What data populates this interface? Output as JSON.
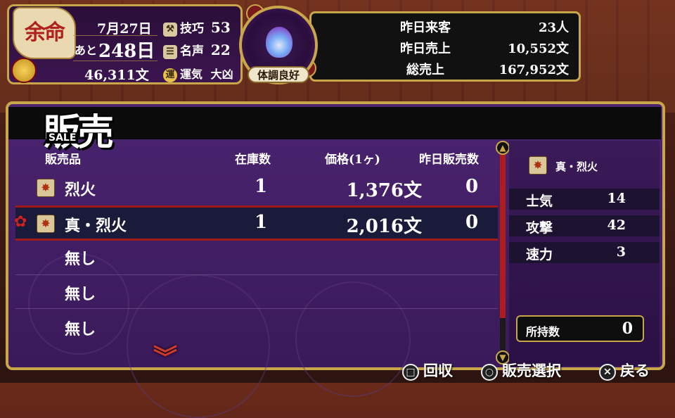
{
  "top_left": {
    "yomei": "余命",
    "date": "7月27日",
    "remaining_prefix": "あと",
    "remaining_days": "248日",
    "money": "46,311文",
    "skill_label": "技巧",
    "skill_value": "53",
    "fame_label": "名声",
    "fame_value": "22",
    "luck_badge": "運",
    "luck_label": "運気",
    "luck_value": "大凶"
  },
  "medallion": {
    "label": "体調良好"
  },
  "top_right": {
    "rows": [
      {
        "label": "昨日来客",
        "value": "23人"
      },
      {
        "label": "昨日売上",
        "value": "10,552文"
      },
      {
        "label": "総売上",
        "value": "167,952文"
      }
    ]
  },
  "title": {
    "main": "販売",
    "sub": "SALE"
  },
  "table": {
    "headers": [
      "販売品",
      "在庫数",
      "価格(1ヶ)",
      "昨日販売数"
    ],
    "rows": [
      {
        "name": "烈火",
        "stock": "1",
        "price": "1,376文",
        "sold": "0"
      },
      {
        "name": "真・烈火",
        "stock": "1",
        "price": "2,016文",
        "sold": "0"
      },
      {
        "name": "無し"
      },
      {
        "name": "無し"
      },
      {
        "name": "無し"
      }
    ]
  },
  "detail": {
    "item_name": "真・烈火",
    "stats": [
      {
        "label": "士気",
        "value": "14"
      },
      {
        "label": "攻撃",
        "value": "42"
      },
      {
        "label": "速力",
        "value": "3"
      }
    ],
    "owned_label": "所持数",
    "owned_value": "0"
  },
  "footer": {
    "collect": "回収",
    "select": "販売選択",
    "back": "戻る"
  },
  "icons": {
    "item": "firework-icon",
    "cursor": "flower-cursor-icon"
  },
  "colors": {
    "gold": "#c9a64a",
    "selected_border": "#a01818",
    "panel_purple": "#3a1a5a"
  }
}
